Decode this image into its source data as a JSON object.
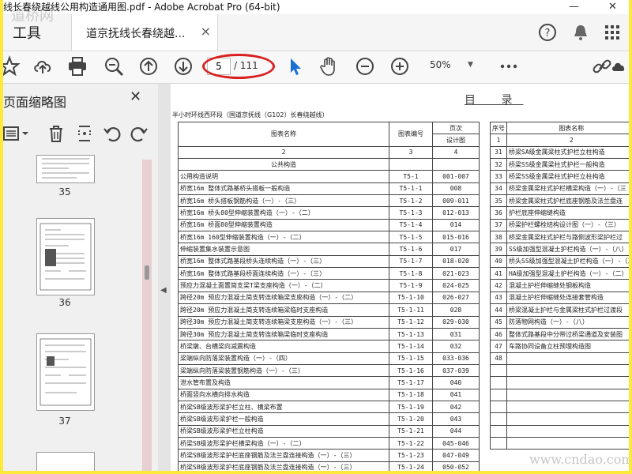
{
  "window": {
    "title": "线长春绕越线公用构造通用图.pdf - Adobe Acrobat Pro (64-bit)",
    "minimize": "—",
    "close": "✕"
  },
  "tabs": {
    "tools": "工具",
    "document": "道京抚线长春绕越...",
    "close": "×"
  },
  "toolbar": {
    "page_current": "5",
    "page_total": "/ 111",
    "zoom": "50%"
  },
  "left_panel": {
    "title": "页面缩略图",
    "close": "✕",
    "thumbnails": [
      {
        "label": "35"
      },
      {
        "label": "36"
      },
      {
        "label": "37"
      }
    ]
  },
  "document": {
    "title": "目 录",
    "subtitle": "半小时环线西环段（国道京抚线（G102）长春绕越线）",
    "left_header": {
      "name": "图表名称",
      "code": "图表编号",
      "page": "页次",
      "page_sub": "设计图",
      "n1": "2",
      "n2": "3",
      "n3": "4",
      "section": "公共构造"
    },
    "left_rows": [
      {
        "name": "公用构造说明",
        "code": "T5-1",
        "page": "001-007"
      },
      {
        "name": "桥宽16m 整体式路基桥头搭板一般构造",
        "code": "T5-1-1",
        "page": "008"
      },
      {
        "name": "桥宽16m 桥头搭板钢筋构造（一）-（三）",
        "code": "T5-1-2",
        "page": "009-011"
      },
      {
        "name": "桥宽16m 桥头80型伸缩装置构造（一）-（二）",
        "code": "T5-1-3",
        "page": "012-013"
      },
      {
        "name": "桥宽16m 桥面80型伸缩装置构造",
        "code": "T5-1-4",
        "page": "014"
      },
      {
        "name": "桥宽16m 160型伸缩装置构造（一）-（二）",
        "code": "T5-1-5",
        "page": "015-016"
      },
      {
        "name": "伸缩装置集水装置示意图",
        "code": "T5-1-6",
        "page": "017"
      },
      {
        "name": "桥宽16m 整体式路基段桥头连续构造（一）-（三）",
        "code": "T5-1-7",
        "page": "018-020"
      },
      {
        "name": "桥宽16m 整体式路基段桥面连续构造（一）-（三）",
        "code": "T5-1-8",
        "page": "021-023"
      },
      {
        "name": "预应力混凝土面置简支梁T梁支座构造（一）-（二）",
        "code": "T5-1-9",
        "page": "024-025"
      },
      {
        "name": "跨径20m 预应力混凝土简支转连续箱梁支座构造（一）-（二）",
        "code": "T5-1-10",
        "page": "026-027"
      },
      {
        "name": "跨径20m 预应力混凝土简支转连续箱梁临时支座构造",
        "code": "T5-1-11",
        "page": "028"
      },
      {
        "name": "跨径30m 预应力混凝土简支转连续箱梁支座构造（一）-（三）",
        "code": "T5-1-12",
        "page": "029-030"
      },
      {
        "name": "跨径30m 预应力混凝土简支转连续箱梁临时支座构造",
        "code": "T5-1-13",
        "page": "031"
      },
      {
        "name": "桥梁墩、台横梁向减震构造",
        "code": "T5-1-14",
        "page": "032"
      },
      {
        "name": "梁端纵向防落梁装置构造（一）-（四）",
        "code": "T5-1-15",
        "page": "033-036"
      },
      {
        "name": "梁端纵向防落梁装置钢筋构造（一）-（三）",
        "code": "T5-1-16",
        "page": "037-039"
      },
      {
        "name": "泄水管布置及构造",
        "code": "T5-1-17",
        "page": "040"
      },
      {
        "name": "桥面竖向水横向排水构造",
        "code": "T5-1-18",
        "page": "041"
      },
      {
        "name": "桥梁SB级波形梁护栏立柱、横梁布置",
        "code": "T5-1-19",
        "page": "042"
      },
      {
        "name": "桥梁SB级波形梁护栏一般构造",
        "code": "T5-1-20",
        "page": "043"
      },
      {
        "name": "桥梁SB级波形梁护栏立柱构造",
        "code": "T5-1-21",
        "page": "044"
      },
      {
        "name": "桥梁SB级波形梁护栏横梁构造（一）-（二）",
        "code": "T5-1-22",
        "page": "045-046"
      },
      {
        "name": "桥梁SB级波形梁护栏底座钢筋及法兰盘连接构造（一）-（三）",
        "code": "T5-1-23",
        "page": "047-049"
      },
      {
        "name": "桥梁SB级波形梁护栏底座钢筋及法兰盘连接构造（一）-（三）",
        "code": "T5-1-24",
        "page": "050-052"
      }
    ],
    "right_header": {
      "seq": "序号",
      "name": "图表名称",
      "n1": "1",
      "n2": "2"
    },
    "right_rows": [
      {
        "seq": "31",
        "name": "桥梁SA级金属梁柱式护栏立柱构造"
      },
      {
        "seq": "32",
        "name": "桥梁SS级金属梁柱式护栏一般构造"
      },
      {
        "seq": "33",
        "name": "桥梁SS级金属梁柱式护栏立柱构造"
      },
      {
        "seq": "34",
        "name": "桥梁金属梁柱式护栏横梁构造（一）-（三"
      },
      {
        "seq": "35",
        "name": "桥梁金属梁柱式护栏底座钢筋及法兰盘连"
      },
      {
        "seq": "36",
        "name": "护栏底座伸缩缝构造"
      },
      {
        "seq": "37",
        "name": "桥梁护栏螺栓结构设计图（一）-（三）"
      },
      {
        "seq": "38",
        "name": "桥梁金属梁柱式护栏与路侧波形梁护栏过"
      },
      {
        "seq": "39",
        "name": "SS级加强型混凝土护栏构造（一）-（八）"
      },
      {
        "seq": "40",
        "name": "桥头SS级加强型混凝土护栏构造（一）-（三"
      },
      {
        "seq": "41",
        "name": "HA级加强型混凝土护栏构造（一）-（二）"
      },
      {
        "seq": "42",
        "name": "混凝土护栏伸缩缝处钢板构造"
      },
      {
        "seq": "43",
        "name": "混凝土护栏伸缩缝处连接套管构造"
      },
      {
        "seq": "44",
        "name": "桥梁混凝土护栏与金属梁柱式护栏过渡段"
      },
      {
        "seq": "45",
        "name": "防落物网构造（一）-（八）"
      },
      {
        "seq": "46",
        "name": "整体式路基段中分带过桥梁通道及安装图"
      },
      {
        "seq": "47",
        "name": "车路协同设备立柱预埋构造图"
      },
      {
        "seq": "48",
        "name": ""
      },
      {
        "seq": "",
        "name": ""
      },
      {
        "seq": "",
        "name": ""
      },
      {
        "seq": "",
        "name": ""
      },
      {
        "seq": "",
        "name": ""
      },
      {
        "seq": "",
        "name": ""
      },
      {
        "seq": "",
        "name": ""
      },
      {
        "seq": "",
        "name": ""
      }
    ]
  },
  "watermarks": {
    "top": "道桥网",
    "bottom": "www.cndao.com"
  }
}
